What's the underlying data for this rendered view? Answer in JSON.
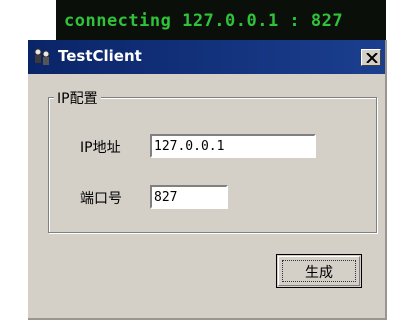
{
  "console": {
    "text": "connecting 127.0.0.1 : 827"
  },
  "window": {
    "title": "TestClient",
    "icon": "app-icon",
    "close_icon": "close-icon"
  },
  "group": {
    "label": "IP配置",
    "ip_label": "IP地址",
    "ip_value": "127.0.0.1",
    "port_label": "端口号",
    "port_value": "827"
  },
  "actions": {
    "generate_label": "生成"
  }
}
